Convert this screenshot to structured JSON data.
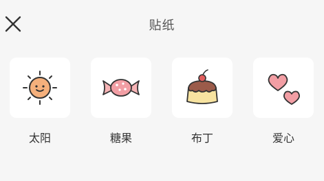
{
  "header": {
    "title": "贴纸",
    "close_icon": "close-icon"
  },
  "stickers": [
    {
      "label": "太阳",
      "icon": "sun-icon"
    },
    {
      "label": "糖果",
      "icon": "candy-icon"
    },
    {
      "label": "布丁",
      "icon": "pudding-icon"
    },
    {
      "label": "爱心",
      "icon": "hearts-icon"
    }
  ]
}
